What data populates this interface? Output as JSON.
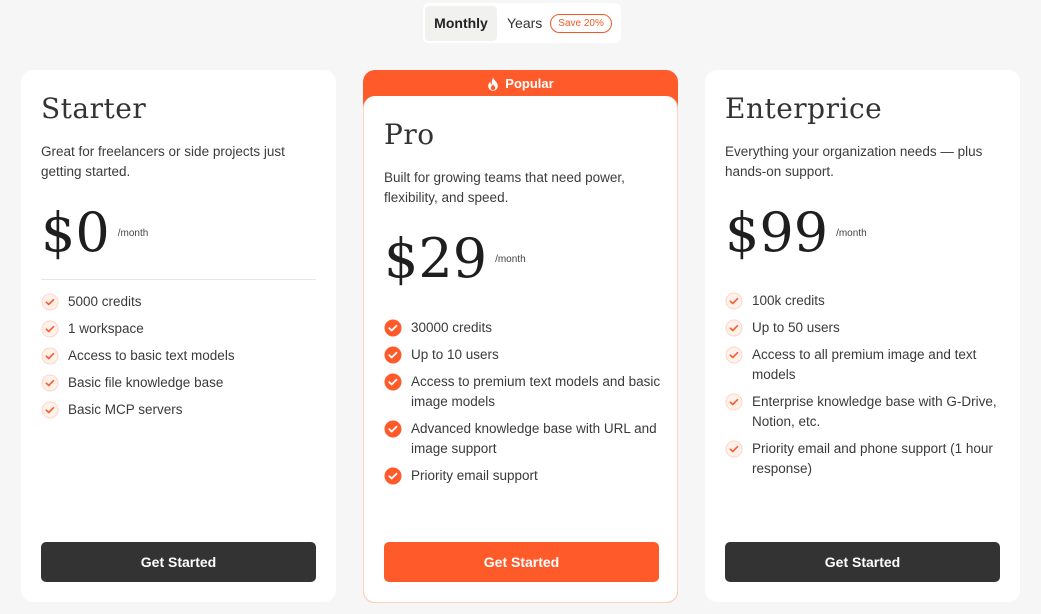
{
  "billing_toggle": {
    "monthly_label": "Monthly",
    "years_label": "Years",
    "save_badge": "Save 20%"
  },
  "colors": {
    "accent": "#ff5a2a",
    "dark_button": "#333333",
    "background": "#f6f6f6"
  },
  "plans": [
    {
      "name": "Starter",
      "description": "Great for freelancers or side projects just getting started.",
      "price": "$0",
      "period": "/month",
      "features": [
        "5000 credits",
        "1 workspace",
        "Access to basic text models",
        "Basic file knowledge base",
        "Basic MCP servers"
      ],
      "cta": "Get Started"
    },
    {
      "name": "Pro",
      "badge": "Popular",
      "badge_icon": "flame-icon",
      "description": "Built for growing teams that need power, flexibility, and speed.",
      "price": "$29",
      "period": "/month",
      "features": [
        "30000 credits",
        "Up to 10 users",
        "Access to premium text models and basic image models",
        "Advanced knowledge base with URL and image support",
        "Priority email support"
      ],
      "cta": "Get Started"
    },
    {
      "name": "Enterprice",
      "description": "Everything your organization needs — plus hands-on support.",
      "price": "$99",
      "period": "/month",
      "features": [
        "100k credits",
        "Up to 50 users",
        "Access to all premium image and text models",
        "Enterprise knowledge base with G-Drive, Notion, etc.",
        "Priority email and phone support (1 hour response)"
      ],
      "cta": "Get Started"
    }
  ]
}
